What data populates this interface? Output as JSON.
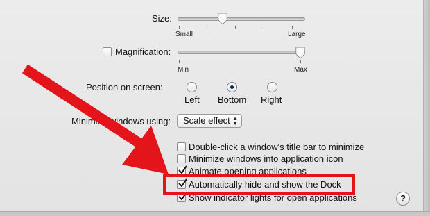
{
  "dock_prefs": {
    "size": {
      "label": "Size:",
      "min_label": "Small",
      "max_label": "Large",
      "value_fraction": 0.35
    },
    "magnification": {
      "label": "Magnification:",
      "checked": false,
      "min_label": "Min",
      "max_label": "Max",
      "value_fraction": 1.0
    },
    "position": {
      "label": "Position on screen:",
      "options": [
        {
          "label": "Left",
          "selected": false
        },
        {
          "label": "Bottom",
          "selected": true
        },
        {
          "label": "Right",
          "selected": false
        }
      ]
    },
    "minimize": {
      "label_start": "Minim",
      "label_end": "ize windows using:",
      "selected": "Scale effect"
    },
    "options": [
      {
        "label": "Double-click a window's title bar to minimize",
        "checked": false
      },
      {
        "label": "Minimize windows into application icon",
        "checked": false
      },
      {
        "label": "Animate opening applications",
        "checked": true
      },
      {
        "label": "Automatically hide and show the Dock",
        "checked": true
      },
      {
        "label": "Show indicator lights for open applications",
        "checked": true
      }
    ],
    "help_label": "?"
  },
  "annotation": {
    "color": "#e3151a",
    "icon": "arrow-icon"
  }
}
